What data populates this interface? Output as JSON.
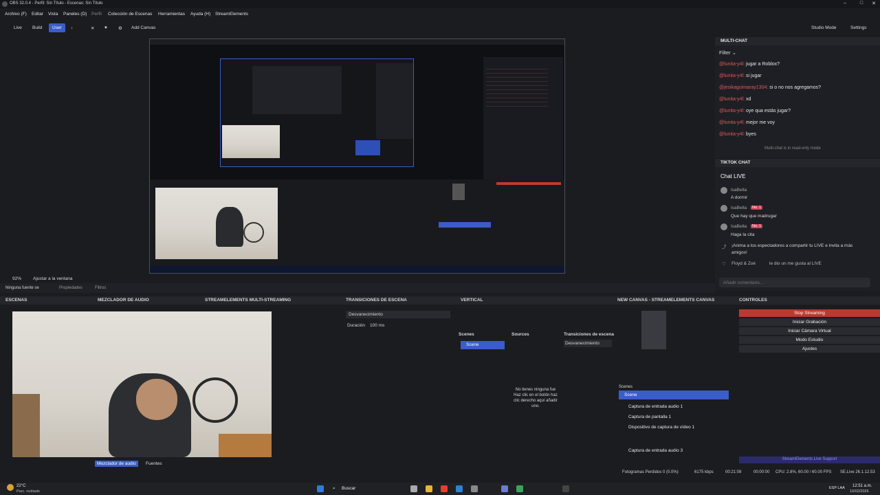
{
  "window": {
    "title": "OBS 32.0.4 - Perfil: Sin Título - Escenas: Sin Título"
  },
  "menu": [
    "Archivo (F)",
    "Editar",
    "Vista",
    "Paneles (D)",
    "Perfil",
    "Colección de Escenas",
    "Herramientas",
    "Ayuda (H)",
    "StreamElements"
  ],
  "toolbar": {
    "live": "Live",
    "build": "Build",
    "user": "User",
    "add_canvas": "Add Canvas",
    "studio_mode": "Studio Mode",
    "settings": "Settings"
  },
  "preview": {
    "zoom": "92%",
    "fit": "Ajustar a la ventana",
    "no_source": "Ninguna fuente se",
    "properties": "Propiedades",
    "filters": "Filtros"
  },
  "multichat": {
    "title": "MULTI-CHAT",
    "filter": "Filter",
    "messages": [
      {
        "user": "@lunita-y4l:",
        "text": "jugar a Roblox?"
      },
      {
        "user": "@lunita-y4l:",
        "text": "si jugar"
      },
      {
        "user": "@jesikaguimaray1304:",
        "text": "si o no nos agregamos?"
      },
      {
        "user": "@lunita-y4l:",
        "text": "xd"
      },
      {
        "user": "@lunita-y4l:",
        "text": "oye qua estás jugar?"
      },
      {
        "user": "@lunita-y4l:",
        "text": "mejor me voy"
      },
      {
        "user": "@lunita-y4l:",
        "text": "byes"
      }
    ],
    "readonly": "Multi-chat is in read-only mode"
  },
  "tiktok": {
    "title": "TIKTOK CHAT",
    "live": "Chat LIVE",
    "messages": [
      {
        "user": "IsaBella",
        "badge": "",
        "text": "A dormir"
      },
      {
        "user": "IsaBella",
        "badge": "No. 1",
        "text": "Que hay que madrugar"
      },
      {
        "user": "IsaBella",
        "badge": "No. 1",
        "text": "Haga la cita"
      }
    ],
    "notice": "¡Anima a los espectadores a compartir tu LIVE e invita a más amigos!",
    "like": "Floyd & Zoé",
    "like_text": "le dio un me gusta al LIVE",
    "placeholder": "Añadir comentario..."
  },
  "docks": {
    "scenes": "ESCENAS",
    "audio": "MEZCLADOR DE AUDIO",
    "multistream": "STREAMELEMENTS MULTI-STREAMING",
    "transitions": "TRANSICIONES DE ESCENA",
    "vertical": "VERTICAL",
    "newcanvas": "NEW CANVAS - STREAMELEMENTS CANVAS",
    "controls": "CONTROLES"
  },
  "transitions": {
    "selected": "Desvanecimiento",
    "duration_label": "Duración",
    "duration": "100 ms"
  },
  "vertical": {
    "scenes": "Scenes",
    "sources": "Sources",
    "transitions": "Transiciones de escena",
    "selected_scene": "Scene",
    "transition": "Desvanecimiento",
    "empty": "No tienes ninguna fue Haz clic en el botón haz clic derecho aquí añadir uno."
  },
  "canvas": {
    "scenes_label": "Scenes",
    "scene": "Scene",
    "sources": [
      "Captura de entrada audio 1",
      "Captura de pantalla 1",
      "Dispositivo de captura de vídeo 1",
      "Captura de entrada audio 3"
    ]
  },
  "controls": {
    "stop": "Stop Streaming",
    "record": "Iniciar Grabación",
    "vcam": "Iniciar Cámara Virtual",
    "studio": "Modo Estudio",
    "settings": "Ajustes",
    "support": "StreamElements Live Support"
  },
  "bottomtabs": {
    "mixer": "Mezclador de audio",
    "sources": "Fuentes"
  },
  "status": {
    "dropped": "Fotogramas Perdidos 0 (0.0%)",
    "kbps": "6175 kbps",
    "time1": "00:21:08",
    "time2": "00:00:00",
    "cpu": "CPU: 2.8%, 60.00 / 60.00 FPS",
    "se": "SE.Live 26.1.12.53"
  },
  "taskbar": {
    "weather": "22°C",
    "weather_sub": "Parc. nublado",
    "search": "Buscar",
    "time": "12:51 a.m.",
    "date": "10/02/2026",
    "lang": "ESP LAA"
  },
  "colors": {
    "accent": "#3b5dc9",
    "stop": "#c0392b",
    "chat_user": "#e05a5a"
  }
}
